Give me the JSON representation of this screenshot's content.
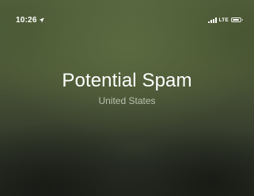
{
  "status_bar": {
    "time": "10:26",
    "network": "LTE",
    "signal_bars": 4,
    "battery_level": 0.85,
    "icons": [
      "location-arrow-icon",
      "signal-icon",
      "battery-icon"
    ]
  },
  "call": {
    "caller_name": "Potential Spam",
    "caller_location": "United States"
  },
  "colors": {
    "text_primary": "#ffffff",
    "text_secondary": "#c8cabd"
  }
}
